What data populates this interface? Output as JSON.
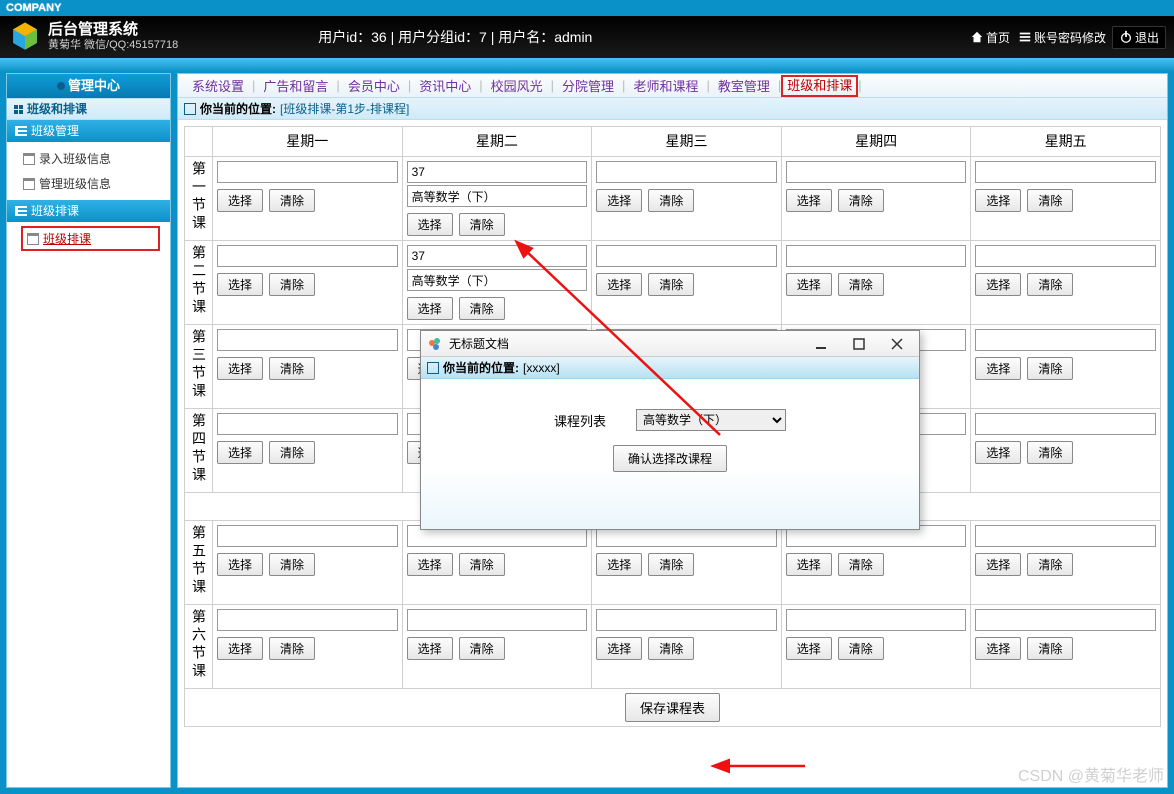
{
  "company": "COMPANY",
  "app_title": "后台管理系统",
  "app_sub": "黄菊华 微信/QQ:45157718",
  "user_line": "用户id：36 | 用户分组id：7 | 用户名：admin",
  "header_links": {
    "home": "首页",
    "pwd": "账号密码修改",
    "logout": "退出"
  },
  "sidebar": {
    "title": "管理中心",
    "section": "班级和排课",
    "group1": {
      "title": "班级管理",
      "items": [
        "录入班级信息",
        "管理班级信息"
      ]
    },
    "group2": {
      "title": "班级排课",
      "items": [
        "班级排课"
      ]
    }
  },
  "topnav": [
    "系统设置",
    "广告和留言",
    "会员中心",
    "资讯中心",
    "校园风光",
    "分院管理",
    "老师和课程",
    "教室管理",
    "班级和排课"
  ],
  "crumb": {
    "label": "你当前的位置:",
    "path": "[班级排课-第1步-排课程]"
  },
  "days": [
    "星期一",
    "星期二",
    "星期三",
    "星期四",
    "星期五"
  ],
  "periods": [
    "第一节课",
    "第二节课",
    "第三节课",
    "第四节课",
    "第五节课",
    "第六节课"
  ],
  "btn_select": "选择",
  "btn_clear": "清除",
  "btn_save": "保存课程表",
  "cells": {
    "p0d1_a": "37",
    "p0d1_b": "高等数学（下）",
    "p1d1_a": "37",
    "p1d1_b": "高等数学（下）"
  },
  "dialog": {
    "title": "无标题文档",
    "crumb_label": "你当前的位置:",
    "crumb_path": "[xxxxx]",
    "list_label": "课程列表",
    "option": "高等数学（下）",
    "confirm": "确认选择改课程"
  },
  "watermark": "CSDN @黄菊华老师"
}
